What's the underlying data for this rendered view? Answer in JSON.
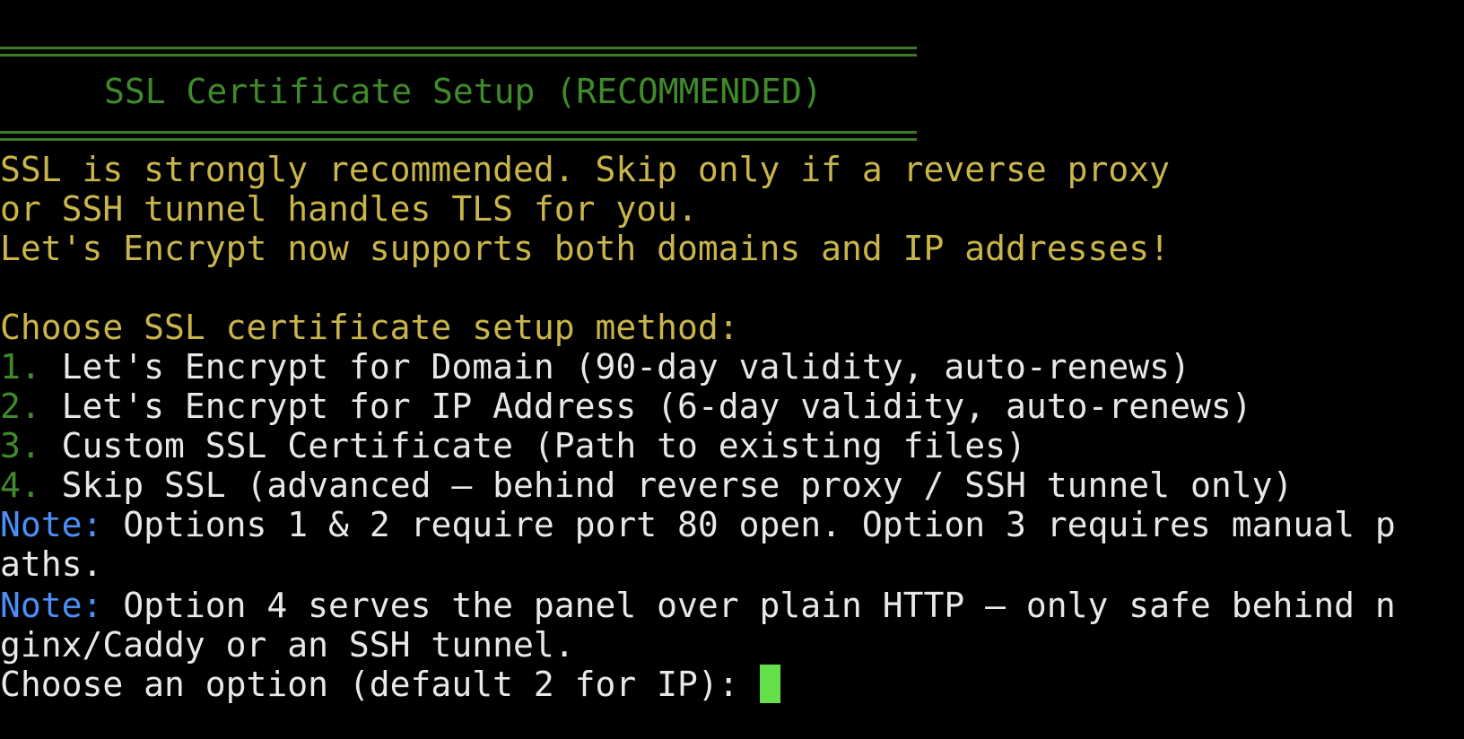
{
  "header": {
    "title": "SSL Certificate Setup (RECOMMENDED)"
  },
  "intro": {
    "line1": "SSL is strongly recommended. Skip only if a reverse proxy",
    "line2": "or SSH tunnel handles TLS for you.",
    "line3": "Let's Encrypt now supports both domains and IP addresses!"
  },
  "menu": {
    "prompt": "Choose SSL certificate setup method:",
    "options": [
      {
        "number": "1.",
        "label": "Let's Encrypt for Domain (90-day validity, auto-renews)"
      },
      {
        "number": "2.",
        "label": "Let's Encrypt for IP Address (6-day validity, auto-renews)"
      },
      {
        "number": "3.",
        "label": "Custom SSL Certificate (Path to existing files)"
      },
      {
        "number": "4.",
        "label": "Skip SSL (advanced — behind reverse proxy / SSH tunnel only)"
      }
    ]
  },
  "notes": [
    {
      "label": "Note:",
      "text_line1": "Options 1 & 2 require port 80 open. Option 3 requires manual p",
      "text_line2": "aths."
    },
    {
      "label": "Note:",
      "text_line1": "Option 4 serves the panel over plain HTTP — only safe behind n",
      "text_line2": "ginx/Caddy or an SSH tunnel."
    }
  ],
  "input": {
    "prompt": "Choose an option (default 2 for IP):",
    "value": ""
  },
  "colors": {
    "background": "#000000",
    "header_green": "#3f8a2a",
    "warning_yellow": "#c9b54a",
    "note_blue": "#4c8ef5",
    "cursor_green": "#66e04a"
  }
}
